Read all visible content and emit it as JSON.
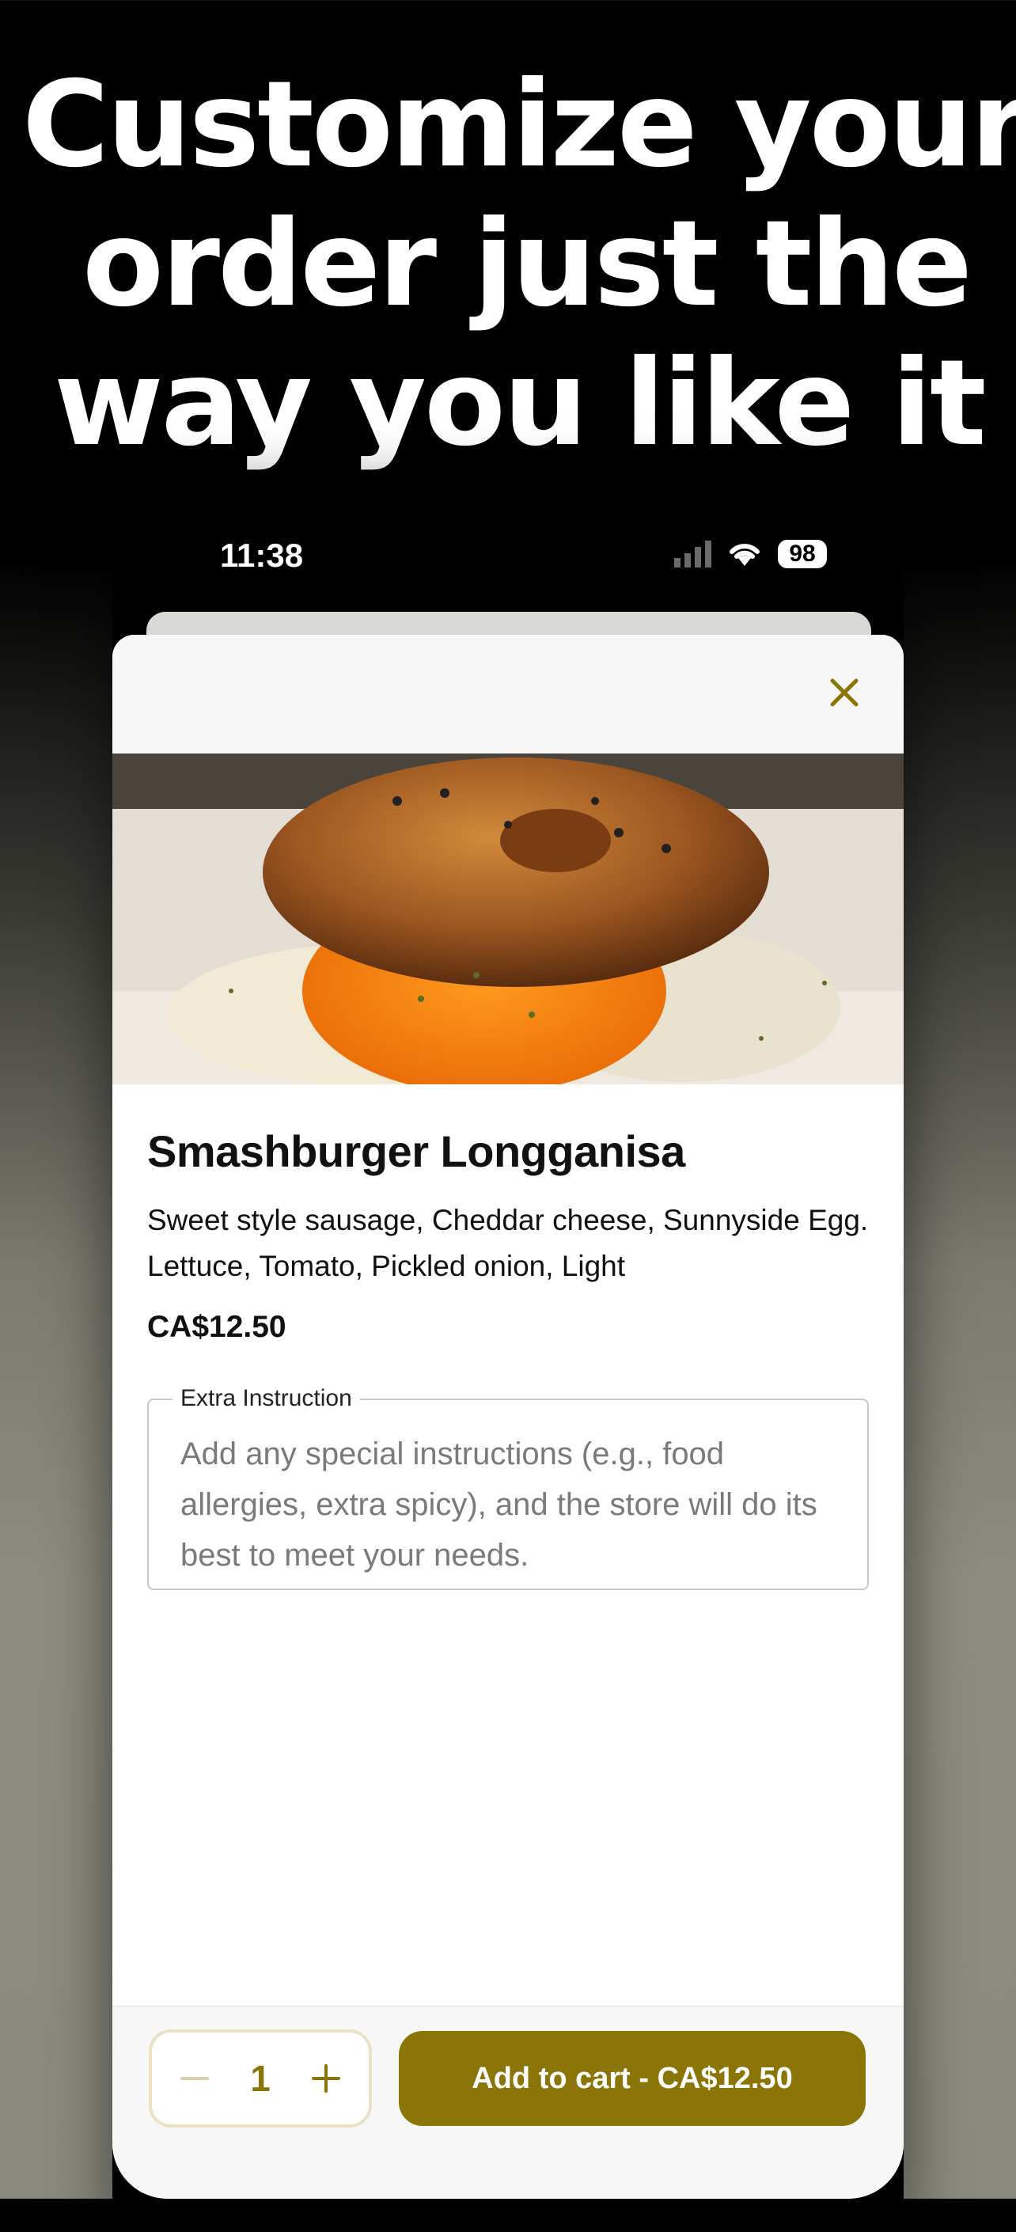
{
  "headline": [
    "Customize your",
    "order just the",
    "way you like it"
  ],
  "status": {
    "time": "11:38",
    "battery": "98"
  },
  "item": {
    "title": "Smashburger Longganisa",
    "description": "Sweet style sausage, Cheddar cheese, Sunnyside Egg. Lettuce, Tomato, Pickled onion, Light",
    "price": "CA$12.50"
  },
  "instruction": {
    "label": "Extra Instruction",
    "placeholder": "Add any special instructions (e.g., food allergies, extra spicy), and the store will do its best to meet your needs."
  },
  "footer": {
    "quantity": "1",
    "cta_label": "Add to cart - CA$12.50"
  },
  "colors": {
    "accent": "#8c7507",
    "stepper_border": "#e9e1c4"
  },
  "icons": {
    "close": "close-icon",
    "minus": "minus-icon",
    "plus": "plus-icon",
    "wifi": "wifi-icon",
    "signal": "signal-icon"
  }
}
